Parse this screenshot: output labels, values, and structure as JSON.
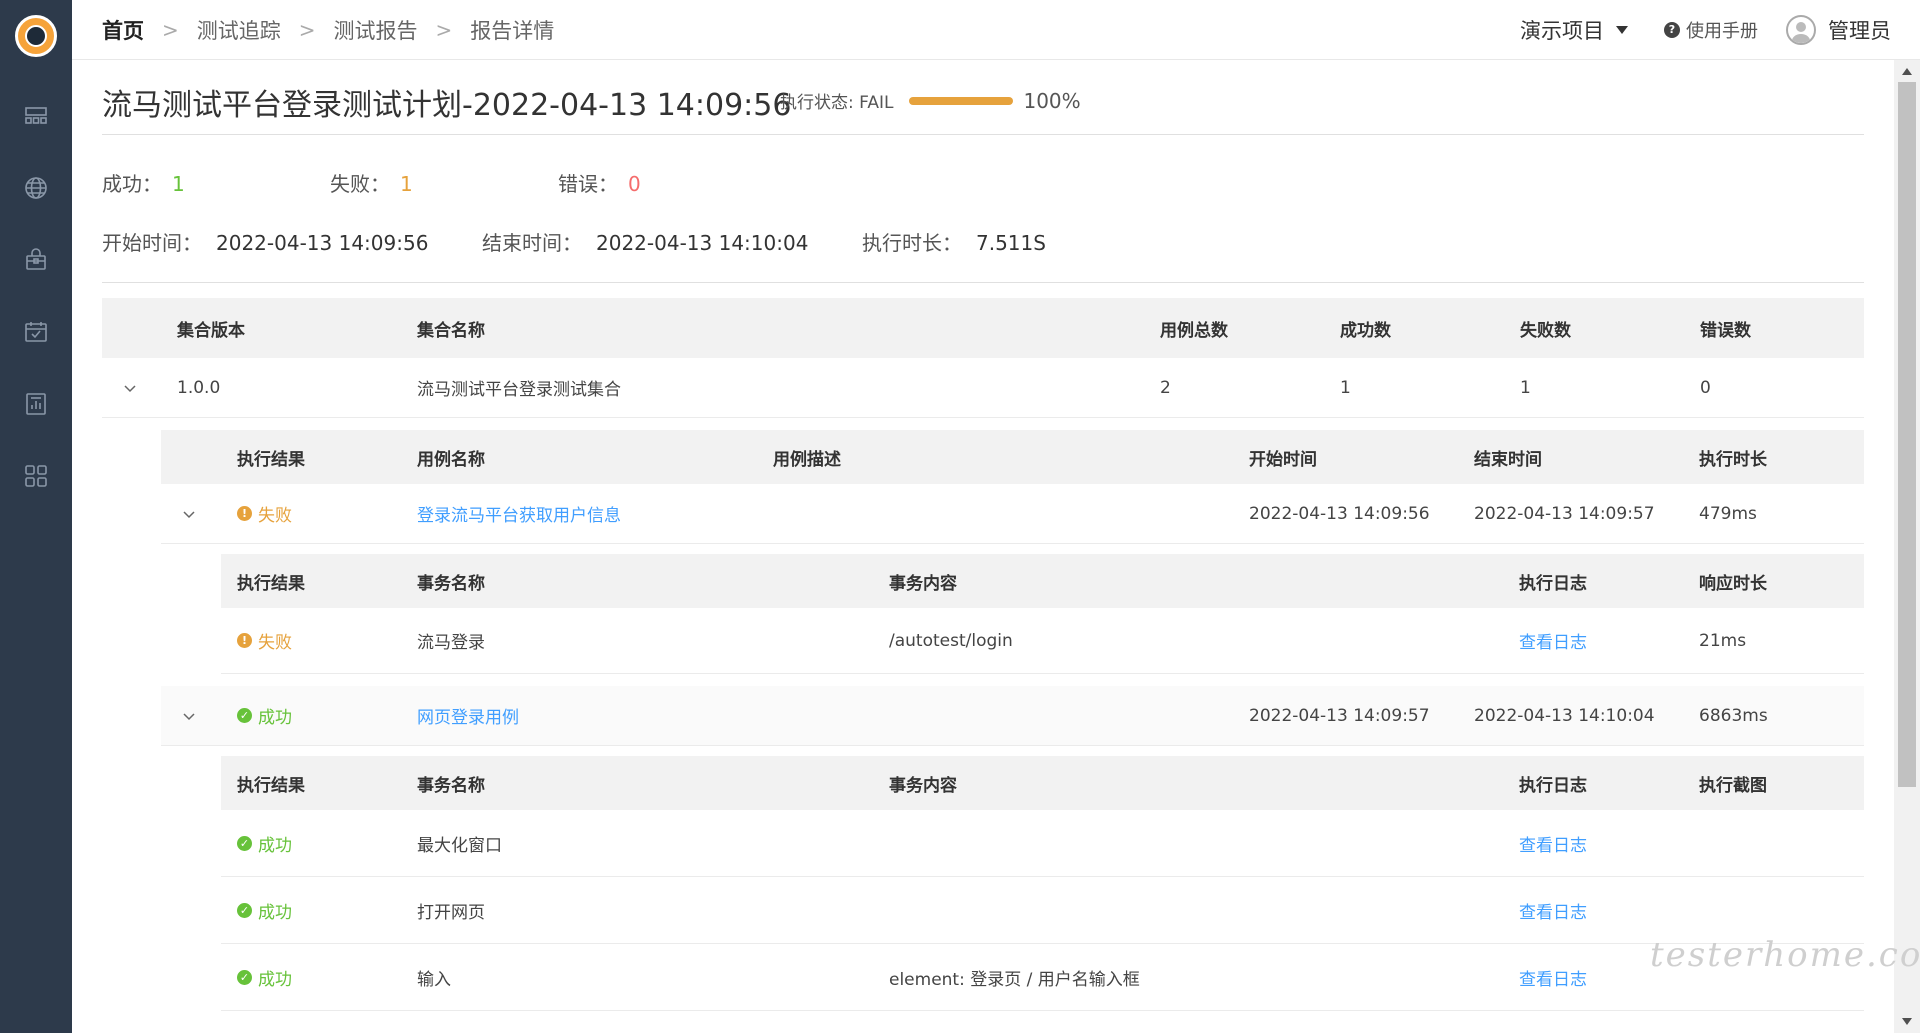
{
  "header": {
    "breadcrumbs": [
      "首页",
      "测试追踪",
      "测试报告",
      "报告详情"
    ],
    "project": "演示项目",
    "manual": "使用手册",
    "user": "管理员"
  },
  "report": {
    "title": "流马测试平台登录测试计划-2022-04-13 14:09:56",
    "status_label": "执行状态: FAIL",
    "progress_pct": "100%",
    "progress_value": 100,
    "success_label": "成功：",
    "success_value": "1",
    "fail_label": "失败：",
    "fail_value": "1",
    "error_label": "错误：",
    "error_value": "0",
    "start_label": "开始时间：",
    "start_value": "2022-04-13 14:09:56",
    "end_label": "结束时间：",
    "end_value": "2022-04-13 14:10:04",
    "duration_label": "执行时长：",
    "duration_value": "7.511S"
  },
  "collection_table": {
    "headers": [
      "集合版本",
      "集合名称",
      "用例总数",
      "成功数",
      "失败数",
      "错误数"
    ],
    "rows": [
      [
        "1.0.0",
        "流马测试平台登录测试集合",
        "2",
        "1",
        "1",
        "0"
      ]
    ]
  },
  "case_table": {
    "headers": [
      "执行结果",
      "用例名称",
      "用例描述",
      "开始时间",
      "结束时间",
      "执行时长"
    ],
    "cases": [
      {
        "result": "失败",
        "name": "登录流马平台获取用户信息",
        "start": "2022-04-13 14:09:56",
        "end": "2022-04-13 14:09:57",
        "duration": "479ms",
        "txn_headers": [
          "执行结果",
          "事务名称",
          "事务内容",
          "执行日志",
          "响应时长"
        ],
        "txns": [
          {
            "result": "失败",
            "name": "流马登录",
            "content": "/autotest/login",
            "log": "查看日志",
            "extra": "21ms"
          }
        ]
      },
      {
        "result": "成功",
        "name": "网页登录用例",
        "start": "2022-04-13 14:09:57",
        "end": "2022-04-13 14:10:04",
        "duration": "6863ms",
        "txn_headers": [
          "执行结果",
          "事务名称",
          "事务内容",
          "执行日志",
          "执行截图"
        ],
        "txns": [
          {
            "result": "成功",
            "name": "最大化窗口",
            "content": "",
            "log": "查看日志",
            "extra": ""
          },
          {
            "result": "成功",
            "name": "打开网页",
            "content": "",
            "log": "查看日志",
            "extra": ""
          },
          {
            "result": "成功",
            "name": "输入",
            "content": "element: 登录页 / 用户名输入框",
            "log": "查看日志",
            "extra": ""
          }
        ]
      }
    ]
  },
  "watermark": "testerhome.com",
  "colors": {
    "sidebar": "#2d3a4b",
    "success": "#67c23a",
    "fail": "#e6a23c",
    "error": "#f56c6c",
    "link": "#409eff"
  }
}
